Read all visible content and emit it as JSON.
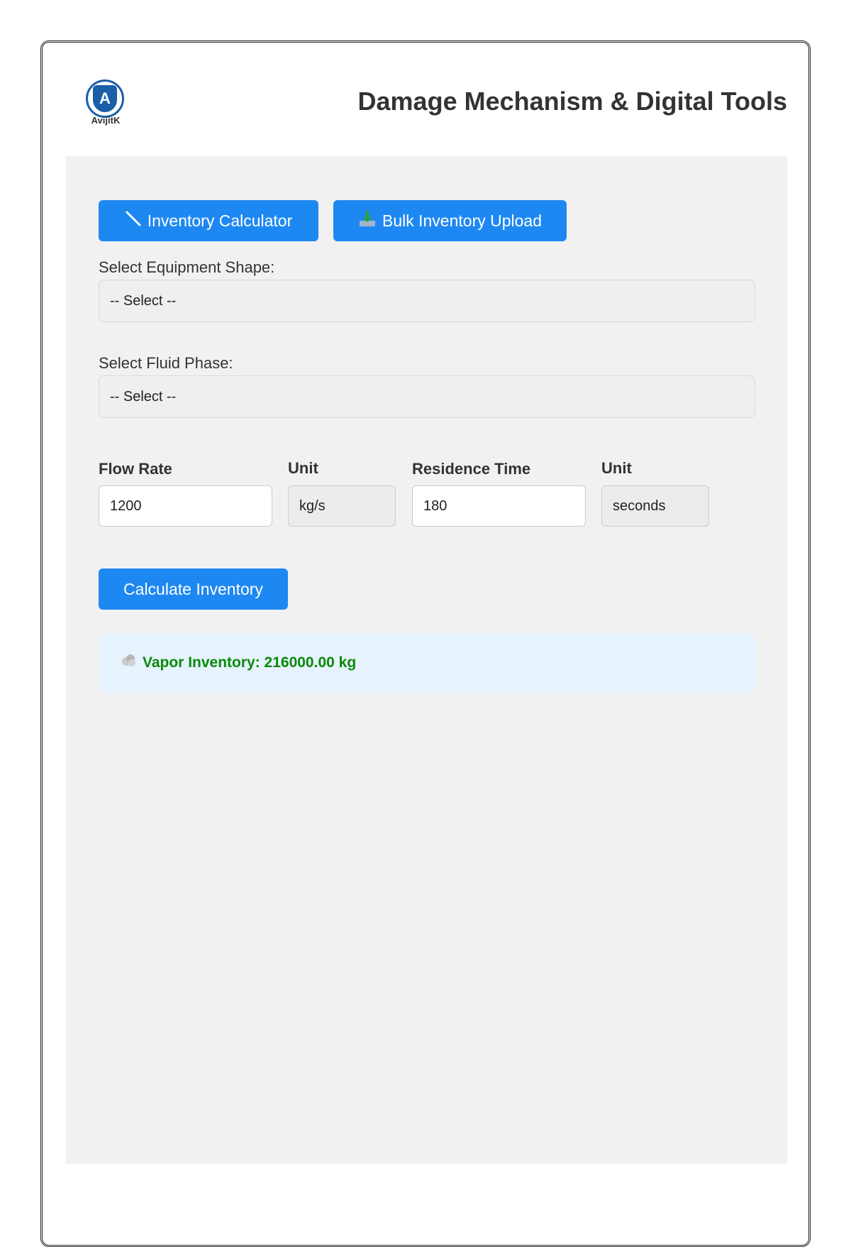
{
  "header": {
    "logo_letter": "A",
    "logo_text": "AvijitK",
    "title": "Damage Mechanism & Digital Tools"
  },
  "tabs": {
    "calculator_icon": "ruler-icon",
    "calculator_label": "Inventory Calculator",
    "bulk_icon": "download-tray-icon",
    "bulk_label": "Bulk Inventory Upload"
  },
  "form": {
    "shape_label": "Select Equipment Shape:",
    "shape_value": "-- Select --",
    "phase_label": "Select Fluid Phase:",
    "phase_value": "-- Select --",
    "flow_rate_label": "Flow Rate",
    "flow_rate_value": "1200",
    "flow_unit_label": "Unit",
    "flow_unit_value": "kg/s",
    "residence_label": "Residence Time",
    "residence_value": "180",
    "residence_unit_label": "Unit",
    "residence_unit_value": "seconds"
  },
  "action": {
    "calculate_label": "Calculate Inventory"
  },
  "result": {
    "icon": "vapor-cloud-icon",
    "text": "Vapor Inventory: 216000.00 kg"
  },
  "colors": {
    "accent": "#1e88f2",
    "result_bg": "#e6f2fd",
    "result_text": "#0a8a0a",
    "logo": "#1a5fa8"
  }
}
